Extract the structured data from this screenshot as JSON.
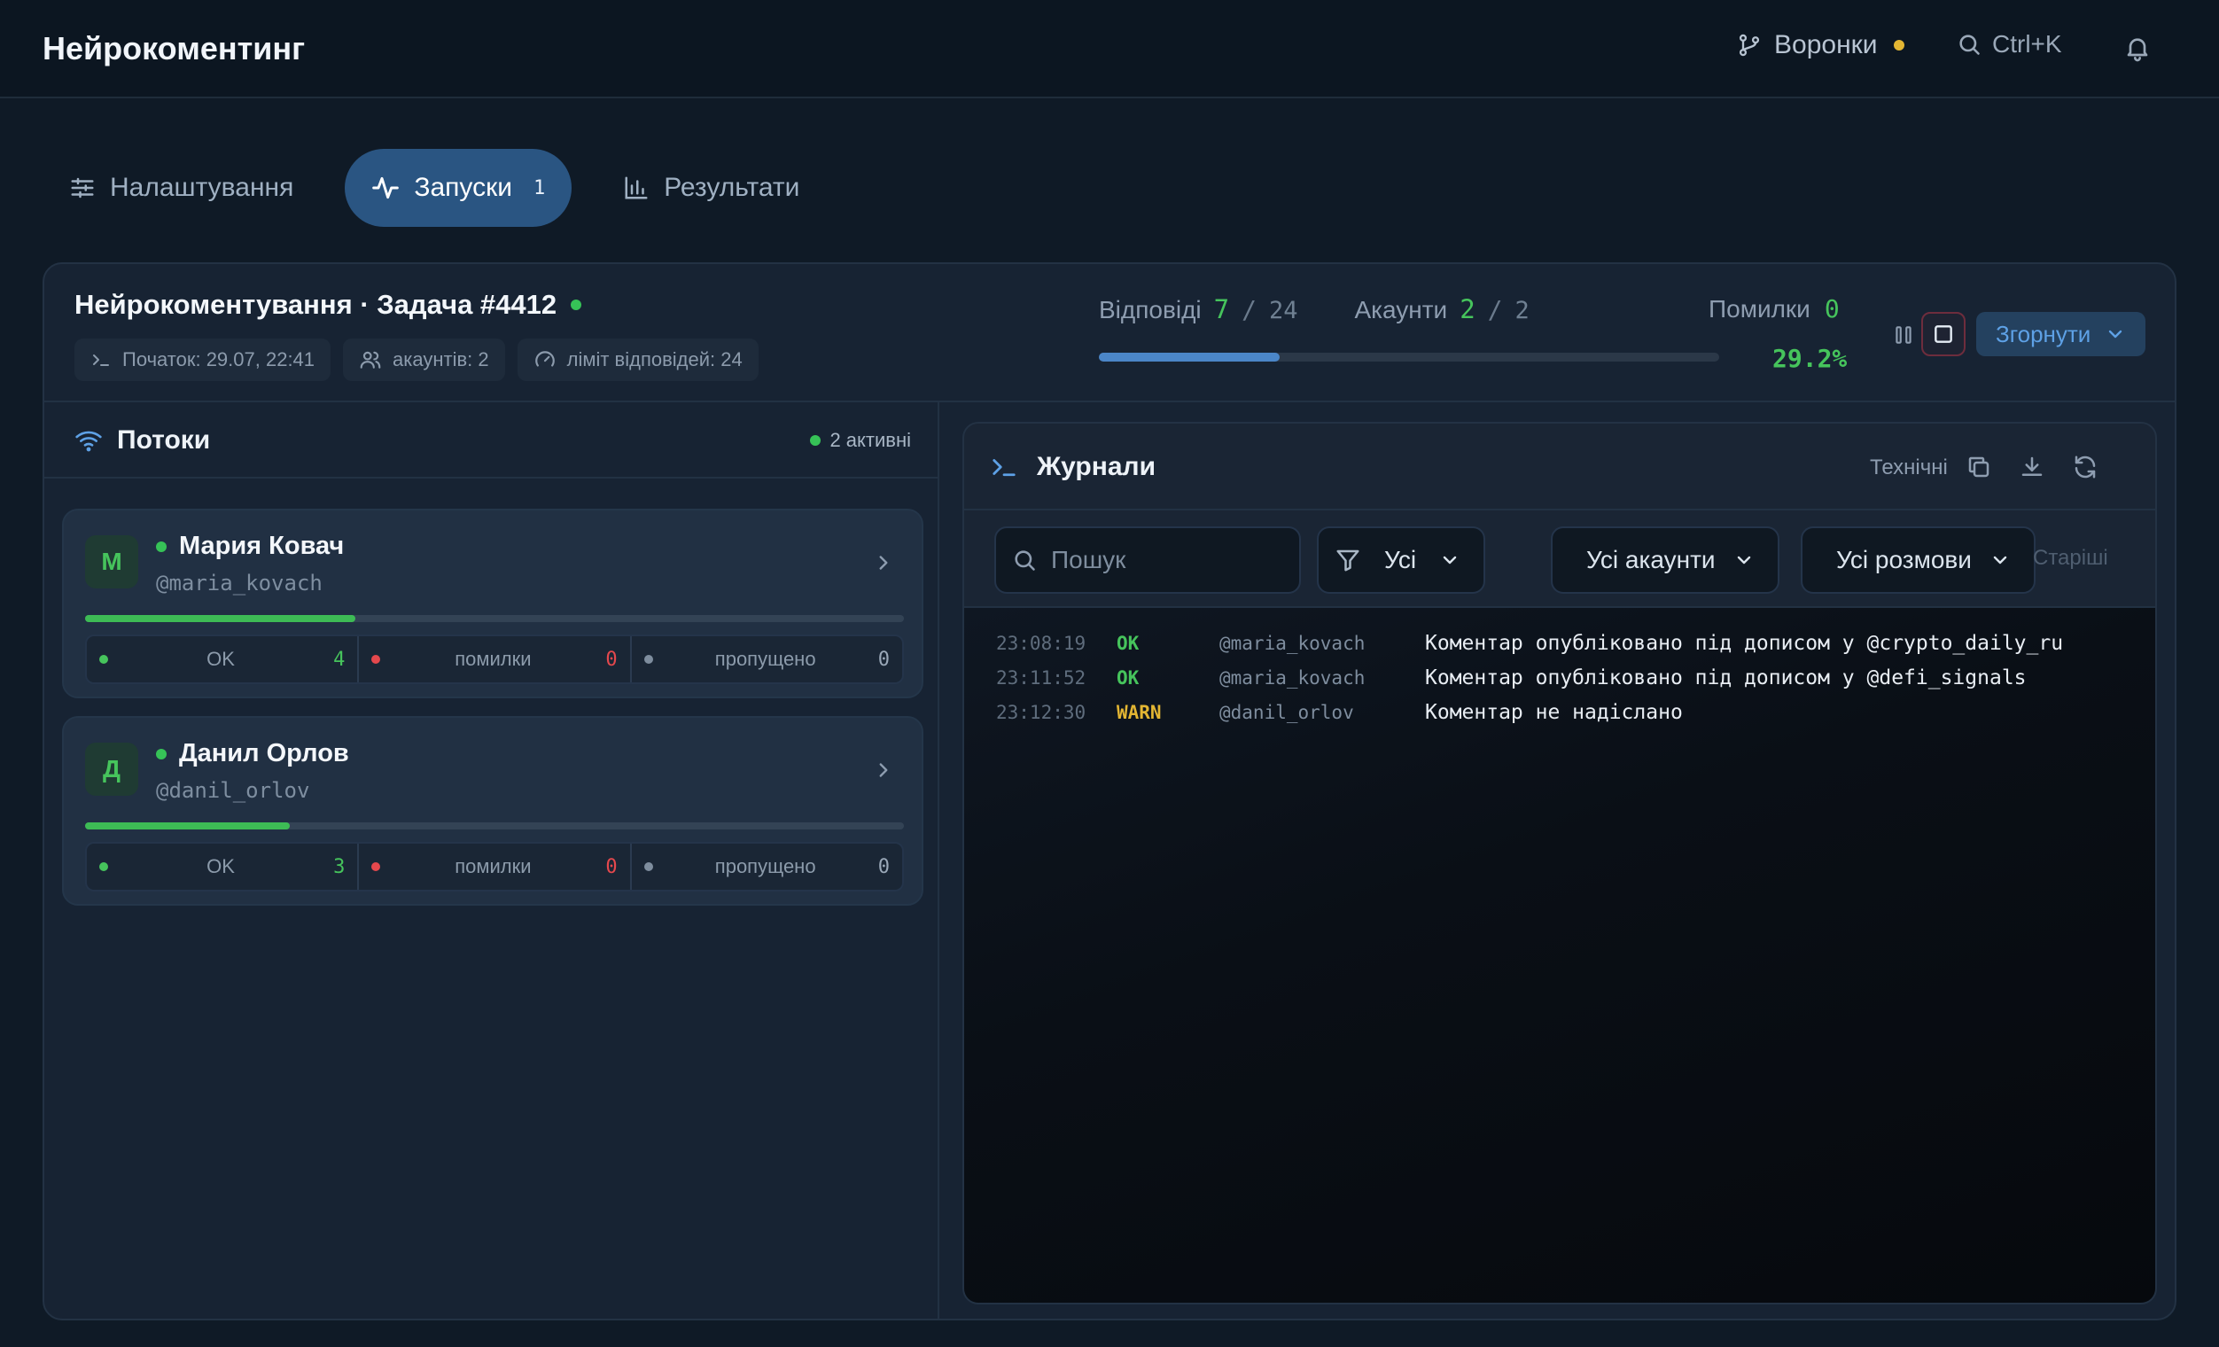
{
  "app": {
    "title": "Нейрокоментинг"
  },
  "topbar": {
    "funnels_label": "Воронки",
    "search_shortcut": "Ctrl+K",
    "funnels_dot_color": "#e3b633"
  },
  "tabs": [
    {
      "label": "Налаштування",
      "icon": "sliders-icon",
      "active": false
    },
    {
      "label": "Запуски",
      "icon": "activity-icon",
      "active": true,
      "badge": "1"
    },
    {
      "label": "Результати",
      "icon": "bar-chart-icon",
      "active": false
    }
  ],
  "task": {
    "title": "Нейрокоментування · Задача #4412",
    "status_color": "#36c257",
    "chips": [
      {
        "icon": "terminal-icon",
        "text": "Початок: 29.07, 22:41"
      },
      {
        "icon": "users-icon",
        "text": "акаунтів: 2"
      },
      {
        "icon": "gauge-icon",
        "text": "ліміт відповідей: 24"
      }
    ],
    "replies": {
      "label": "Відповіді",
      "done": "7",
      "sep": "/",
      "total": "24"
    },
    "accounts": {
      "label": "Акаунти",
      "done": "2",
      "sep": "/",
      "total": "2"
    },
    "errors": {
      "label": "Помилки",
      "value": "0"
    },
    "progress": 0.292,
    "percent_text": "29.2%",
    "collapse_label": "Згорнути"
  },
  "streams": {
    "title": "Потоки",
    "active_text": "2 активні",
    "items": [
      {
        "initial": "М",
        "name": "Мария Ковач",
        "handle": "@maria_kovach",
        "progress": 0.33,
        "ok_label": "OK",
        "ok": "4",
        "err_label": "помилки",
        "err": "0",
        "skip_label": "пропущено",
        "skip": "0"
      },
      {
        "initial": "Д",
        "name": "Данил Орлов",
        "handle": "@danil_orlov",
        "progress": 0.25,
        "ok_label": "OK",
        "ok": "3",
        "err_label": "помилки",
        "err": "0",
        "skip_label": "пропущено",
        "skip": "0"
      }
    ]
  },
  "logs": {
    "title": "Журнали",
    "technical_label": "Технічні",
    "search_placeholder": "Пошук",
    "level_filter": "Усі",
    "accounts_filter": "Усі акаунти",
    "conversations_filter": "Усі розмови",
    "older_label": "Старіші",
    "entries": [
      {
        "time": "23:08:19",
        "level": "OK",
        "handle": "@maria_kovach",
        "message": "Коментар опубліковано під дописом у @crypto_daily_ru"
      },
      {
        "time": "23:11:52",
        "level": "OK",
        "handle": "@maria_kovach",
        "message": "Коментар опубліковано під дописом у @defi_signals"
      },
      {
        "time": "23:12:30",
        "level": "WARN",
        "handle": "@danil_orlov",
        "message": "Коментар не надіслано"
      }
    ]
  },
  "colors": {
    "ok": "#46c45c",
    "warn": "#e3b633",
    "error": "#e5484d",
    "accent": "#4b86c8"
  }
}
